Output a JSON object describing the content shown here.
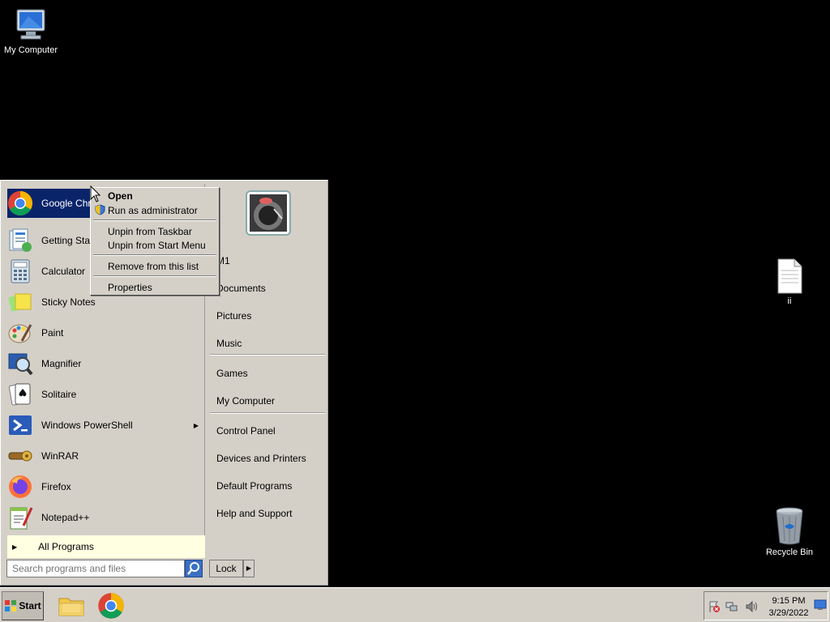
{
  "desktop": {
    "icons": [
      {
        "label": "My Computer"
      },
      {
        "label": "ii"
      },
      {
        "label": "Recycle Bin"
      }
    ]
  },
  "start_menu": {
    "programs": [
      {
        "label": "Google Chrome",
        "icon": "chrome-icon",
        "selected": true
      },
      {
        "label": "Getting Started",
        "icon": "getting-started-icon"
      },
      {
        "label": "Calculator",
        "icon": "calculator-icon"
      },
      {
        "label": "Sticky Notes",
        "icon": "sticky-notes-icon"
      },
      {
        "label": "Paint",
        "icon": "paint-icon"
      },
      {
        "label": "Magnifier",
        "icon": "magnifier-icon"
      },
      {
        "label": "Solitaire",
        "icon": "solitaire-icon"
      },
      {
        "label": "Windows PowerShell",
        "icon": "powershell-icon",
        "has_submenu": true
      },
      {
        "label": "WinRAR",
        "icon": "winrar-icon"
      },
      {
        "label": "Firefox",
        "icon": "firefox-icon"
      },
      {
        "label": "Notepad++",
        "icon": "notepadpp-icon"
      }
    ],
    "all_programs": "All Programs",
    "right_items": {
      "user": "M1",
      "documents": "Documents",
      "pictures": "Pictures",
      "music": "Music",
      "games": "Games",
      "my_computer": "My Computer",
      "control_panel": "Control Panel",
      "devices": "Devices and Printers",
      "default_programs": "Default Programs",
      "help": "Help and Support"
    },
    "search_placeholder": "Search programs and files",
    "lock_label": "Lock"
  },
  "context_menu": {
    "open": "Open",
    "run_as_admin": "Run as administrator",
    "unpin_taskbar": "Unpin from Taskbar",
    "unpin_start": "Unpin from Start Menu",
    "remove_list": "Remove from this list",
    "properties": "Properties"
  },
  "taskbar": {
    "start_label": "Start",
    "time": "9:15 PM",
    "date": "3/29/2022"
  },
  "colors": {
    "selection": "#0a246a",
    "menu_bg": "#d4d0c8",
    "all_programs_bg": "#ffffe1"
  }
}
